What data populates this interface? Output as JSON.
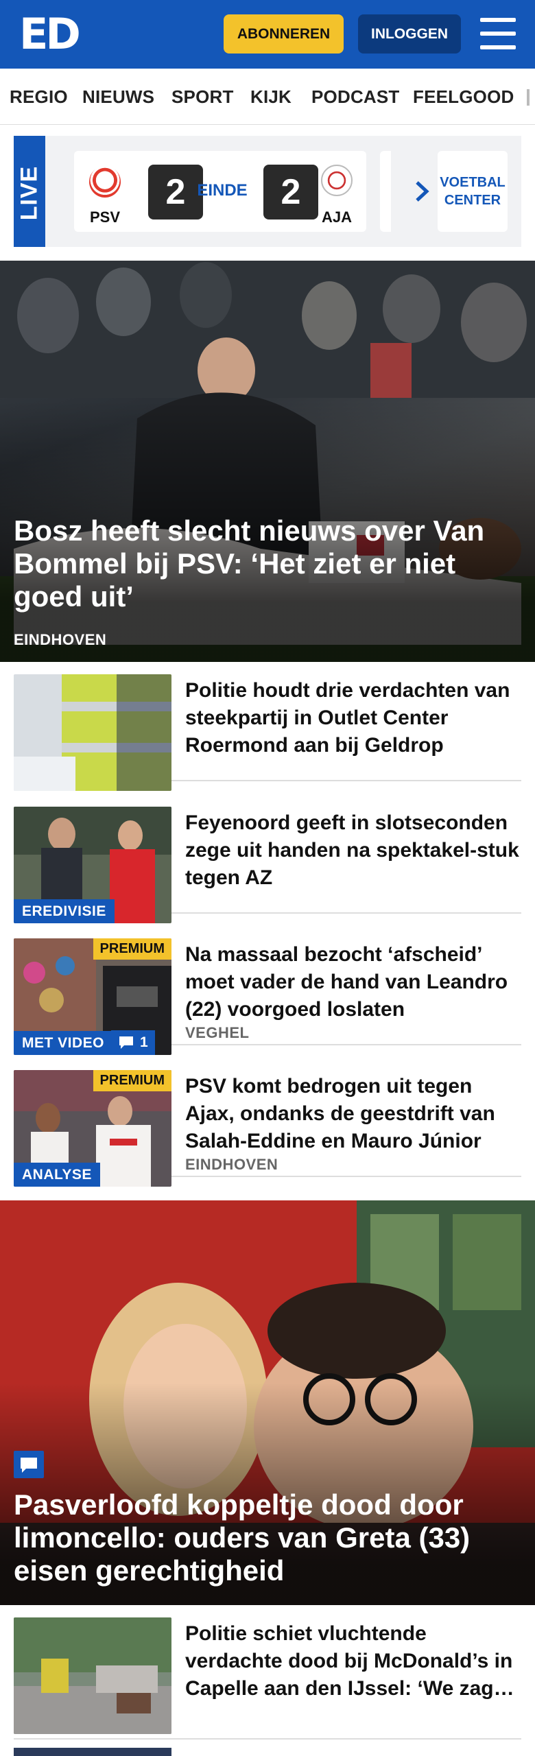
{
  "header": {
    "logo": "ED",
    "subscribe_label": "ABONNEREN",
    "login_label": "INLOGGEN",
    "brand_color": "#1457b8",
    "accent_color": "#f3c22b"
  },
  "nav": {
    "items": [
      "REGIO",
      "NIEUWS",
      "SPORT",
      "KIJK",
      "PODCAST",
      "FEELGOOD"
    ]
  },
  "live": {
    "label": "LIVE",
    "match": {
      "home": "PSV",
      "home_score": "2",
      "status": "EINDE",
      "away_score": "2",
      "away": "AJA"
    },
    "center_label_line1": "VOETBAL",
    "center_label_line2": "CENTER"
  },
  "hero": {
    "title": "Bosz heeft slecht nieuws over Van Bommel bij PSV: ‘Het ziet er niet goed uit’",
    "location": "EINDHOVEN"
  },
  "articles": [
    {
      "title": "Politie houdt drie verdachten van steekpartij in Outlet Center Roermond aan bij Geldrop"
    },
    {
      "title": "Feyenoord geeft in slotseconden zege uit handen na spektakel-stuk tegen AZ",
      "tag": "EREDIVISIE"
    },
    {
      "title": "Na massaal bezocht ‘afscheid’ moet vader de hand van Leandro (22) voorgoed loslaten",
      "premium": "PREMIUM",
      "tag": "MET VIDEO",
      "comments": "1",
      "location": "VEGHEL"
    },
    {
      "title": "PSV komt bedrogen uit tegen Ajax, ondanks de geestdrift van Salah-Eddine en Mauro Júnior",
      "premium": "PREMIUM",
      "tag": "ANALYSE",
      "location": "EINDHOVEN"
    }
  ],
  "feature": {
    "title": "Pasverloofd koppeltje dood door limoncello: ouders van Greta (33) eisen gerechtigheid"
  },
  "bottom_article": {
    "title": "Politie schiet vluchtende verdachte dood bij McDonald’s in Capelle aan den IJssel: ‘We zag…"
  }
}
